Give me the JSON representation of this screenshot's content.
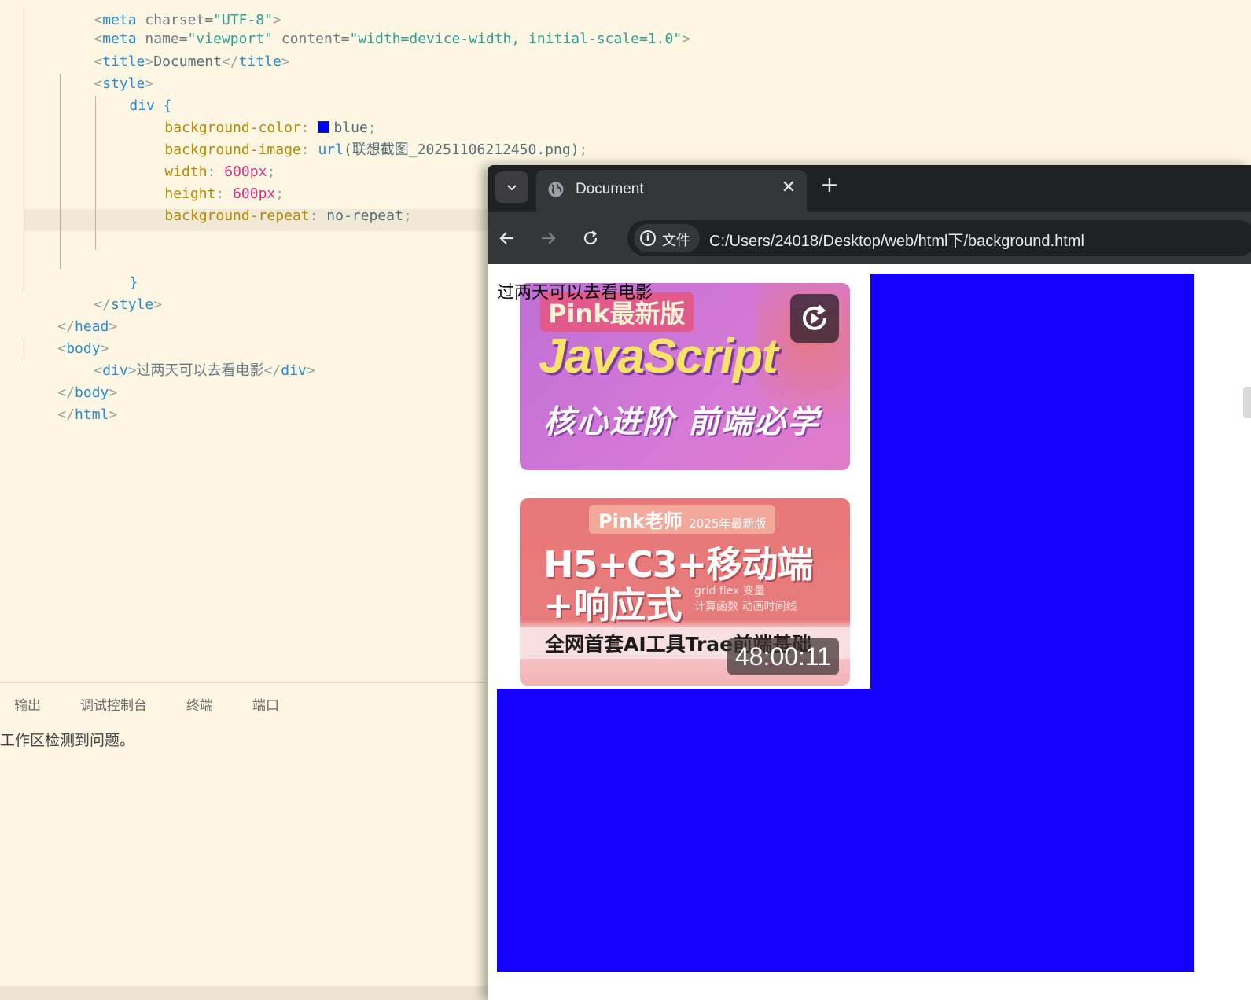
{
  "editor": {
    "lines": {
      "l0": [
        "<",
        "meta",
        " charset=",
        "\"UTF-8\"",
        ">"
      ],
      "l1": {
        "open": "<",
        "tag": "meta",
        "a1": " name=",
        "v1": "\"viewport\"",
        "a2": " content=",
        "v2": "\"width=device-width, initial-scale=1.0\"",
        "close": ">"
      },
      "l2": {
        "open": "<",
        "tag": "title",
        "close1": ">",
        "text": "Document",
        "open2": "</",
        "tag2": "title",
        "close2": ">"
      },
      "l3": {
        "open": "<",
        "tag": "style",
        "close": ">"
      },
      "l4": {
        "selector": "div",
        "brace": " {"
      },
      "l5": {
        "prop": "background-color",
        "colon": ": ",
        "value": "blue",
        "semi": ";"
      },
      "l6": {
        "prop": "background-image",
        "colon": ": ",
        "fn": "url",
        "arg": "(联想截图_20251106212450.png)",
        "semi": ";"
      },
      "l7": {
        "prop": "width",
        "colon": ": ",
        "num": "600",
        "unit": "px",
        "semi": ";"
      },
      "l8": {
        "prop": "height",
        "colon": ": ",
        "num": "600",
        "unit": "px",
        "semi": ";"
      },
      "l9": {
        "prop": "background-repeat",
        "colon": ": ",
        "value": "no-repeat",
        "semi": ";"
      },
      "l11": {
        "brace": "}"
      },
      "l12": {
        "open": "</",
        "tag": "style",
        "close": ">"
      },
      "l13": {
        "open": "</",
        "tag": "head",
        "close": ">"
      },
      "l14": {
        "open": "<",
        "tag": "body",
        "close": ">"
      },
      "l15": {
        "open": "<",
        "tag": "div",
        "close1": ">",
        "text": "过两天可以去看电影",
        "open2": "</",
        "tag2": "div",
        "close2": ">"
      },
      "l16": {
        "open": "</",
        "tag": "body",
        "close": ">"
      },
      "l17": {
        "open": "</",
        "tag": "html",
        "close": ">"
      }
    },
    "swatch_color": "#0000ff"
  },
  "panel": {
    "tabs": [
      "输出",
      "调试控制台",
      "终端",
      "端口"
    ],
    "message": "工作区检测到问题。"
  },
  "browser": {
    "tab_title": "Document",
    "tab_close": "✕",
    "new_tab": "+",
    "site_label": "文件",
    "url": "C:/Users/24018/Desktop/web/html下/background.html",
    "page": {
      "div_text": "过两天可以去看电影",
      "div_bg_color": "#1400ff",
      "card1": {
        "badge": "Pink最新版",
        "title": "JavaScript",
        "subtitle": "核心进阶 前端必学"
      },
      "card2": {
        "badge": "Pink老师",
        "badge_year": "2025年最新版",
        "title_line1": "H5+C3+移动端",
        "title_line2": "+响应式",
        "tags_line1": "grid  flex  变量",
        "tags_line2": "计算函数  动画时间线",
        "banner": "全网首套AI工具Trae前端基础",
        "duration": "48:00:11"
      }
    }
  }
}
